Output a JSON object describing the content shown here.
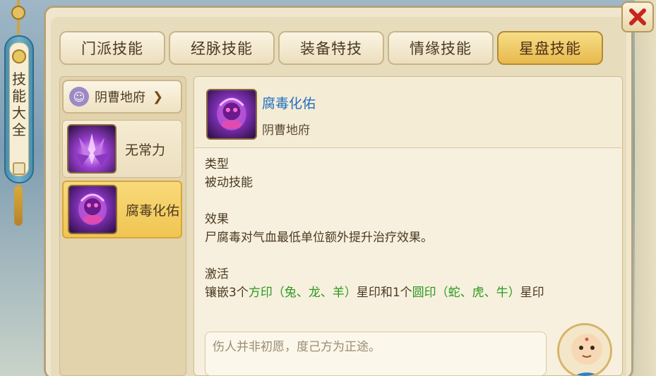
{
  "side_scroll": {
    "title": "技能大全"
  },
  "tabs": [
    {
      "label": "门派技能",
      "active": false
    },
    {
      "label": "经脉技能",
      "active": false
    },
    {
      "label": "装备特技",
      "active": false
    },
    {
      "label": "情缘技能",
      "active": false
    },
    {
      "label": "星盘技能",
      "active": true
    }
  ],
  "school_select": {
    "value": "阴曹地府"
  },
  "skill_list": [
    {
      "label": "无常力",
      "icon": "spiky-purple-skill-icon",
      "selected": false
    },
    {
      "label": "腐毒化佑",
      "icon": "ghost-purple-skill-icon",
      "selected": true
    }
  ],
  "detail": {
    "name": "腐毒化佑",
    "school": "阴曹地府",
    "type_heading": "类型",
    "type_value": "被动技能",
    "effect_heading": "效果",
    "effect_value": "尸腐毒对气血最低单位额外提升治疗效果。",
    "activate_heading": "激活",
    "activate_parts": {
      "p1": "镶嵌3个",
      "g1": "方印（兔、龙、羊）",
      "p2": "星印和1个",
      "g2": "圆印（蛇、虎、牛）",
      "p3": "星印"
    }
  },
  "quote": "伤人并非初愿，度己方为正途。",
  "colors": {
    "accent_blue": "#1f6fbf",
    "accent_green": "#2a9a1e",
    "tab_active": "#f0c552"
  }
}
